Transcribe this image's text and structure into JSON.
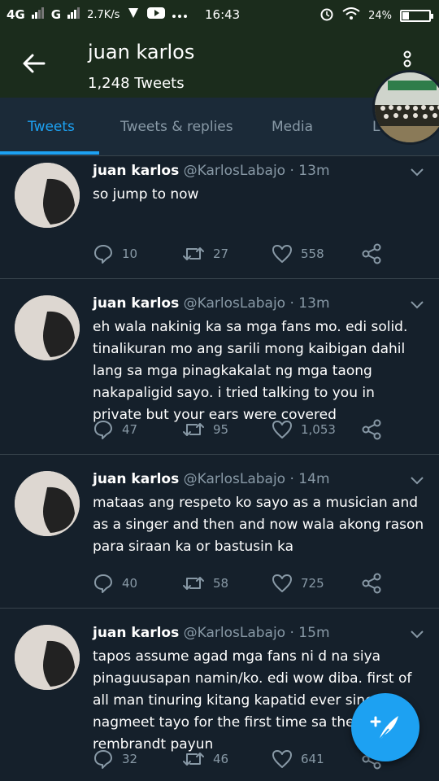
{
  "status_bar": {
    "network1": "4G",
    "network2": "G",
    "speed": "2.7K/s",
    "time": "16:43",
    "battery_percent": "24%",
    "battery_level": 0.24
  },
  "header": {
    "name": "juan karlos",
    "tweet_count": "1,248 Tweets"
  },
  "tabs": [
    {
      "label": "Tweets",
      "active": true
    },
    {
      "label": "Tweets & replies",
      "active": false
    },
    {
      "label": "Media",
      "active": false
    },
    {
      "label": "Likes",
      "active": false
    }
  ],
  "tweets": [
    {
      "name": "juan karlos",
      "handle": "@KarlosLabajo",
      "time": "· 13m",
      "text": "so jump to now",
      "replies": "10",
      "retweets": "27",
      "likes": "558"
    },
    {
      "name": "juan karlos",
      "handle": "@KarlosLabajo",
      "time": "· 13m",
      "text": "eh wala nakinig ka sa mga fans mo. edi solid. tinalikuran mo ang sarili mong kaibigan dahil lang sa mga pinagkakalat ng mga taong nakapaligid sayo. i tried talking to you in private but your ears were covered",
      "replies": "47",
      "retweets": "95",
      "likes": "1,053"
    },
    {
      "name": "juan karlos",
      "handle": "@KarlosLabajo",
      "time": "· 14m",
      "text": "mataas ang respeto ko sayo as a musician and as a singer and then and now wala akong rason para siraan ka or bastusin ka",
      "replies": "40",
      "retweets": "58",
      "likes": "725"
    },
    {
      "name": "juan karlos",
      "handle": "@KarlosLabajo",
      "time": "· 15m",
      "text": "tapos assume agad mga fans ni d na siya pinaguusapan namin/ko. edi wow diba. first of all man tinuring kitang kapatid ever since nagmeet tayo for the first time sa the voice sa rembrandt payun",
      "replies": "32",
      "retweets": "46",
      "likes": "641"
    }
  ],
  "colors": {
    "accent": "#1da1f2",
    "background": "#15202b",
    "header": "#1b2c1c",
    "secondary_text": "#8899a6"
  }
}
